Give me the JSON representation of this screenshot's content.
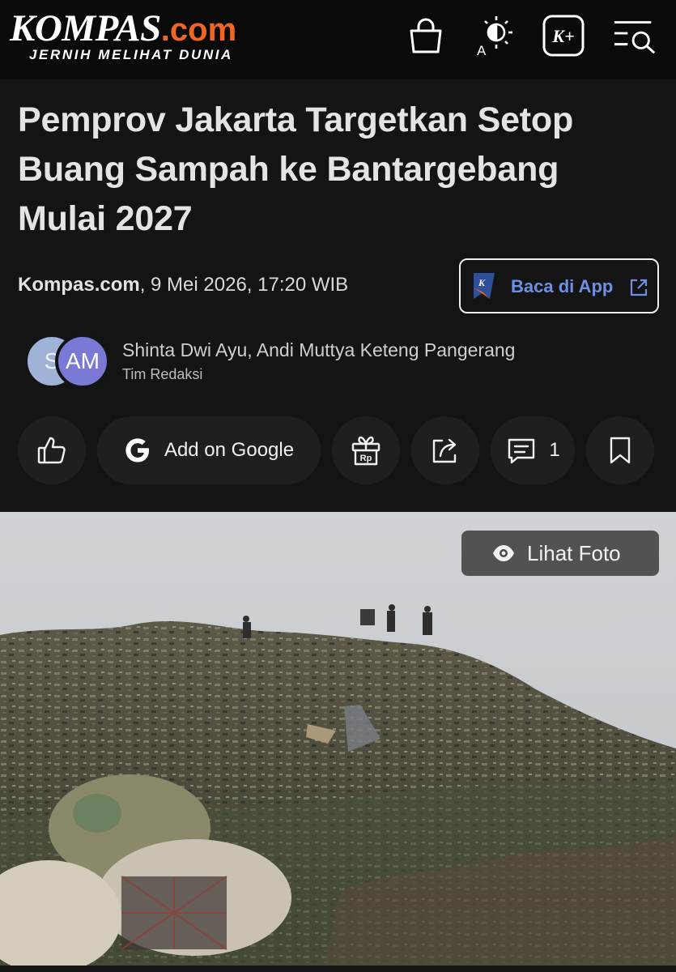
{
  "header": {
    "logo_main": "KOMPAS",
    "logo_suffix": ".com",
    "logo_tagline": "JERNIH MELIHAT DUNIA",
    "icons": [
      "shopping-bag-icon",
      "theme-toggle-icon",
      "kompas-plus-icon",
      "search-menu-icon"
    ],
    "kplus_label": "K+",
    "theme_letter": "A"
  },
  "article": {
    "title": "Pemprov Jakarta Targetkan Setop Buang Sampah ke Bantargebang Mulai 2027",
    "source": "Kompas.com",
    "datetime": ", 9 Mei 2026, 17:20 WIB",
    "app_button_label": "Baca di App",
    "app_logo_letter": "K"
  },
  "authors": {
    "avatar_1_initial": "S",
    "avatar_2_initials": "AM",
    "names": "Shinta Dwi Ayu,  Andi Muttya Keteng Pangerang",
    "team": "Tim Redaksi"
  },
  "actions": {
    "google_label": "Add on Google",
    "gift_label": "Rp",
    "comment_count": "1"
  },
  "photo": {
    "view_button_label": "Lihat Foto"
  },
  "colors": {
    "background": "#141414",
    "header": "#0a0a0a",
    "brand_orange": "#f26522",
    "app_blue": "#6d8fe6",
    "action_bg": "#1f1f1f",
    "avatar_1": "#9fb2d8",
    "avatar_2": "#7b79d6"
  }
}
